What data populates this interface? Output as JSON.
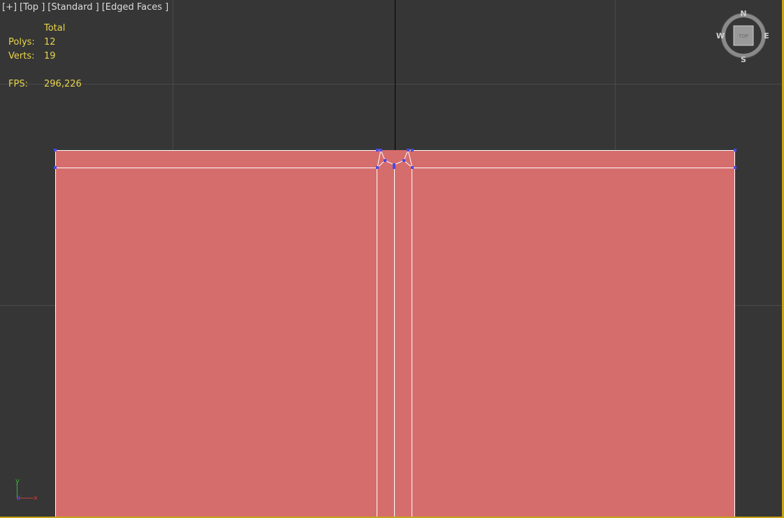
{
  "viewport_label": {
    "plus": "[+]",
    "view": "[Top ]",
    "shading": "[Standard ]",
    "edges": "[Edged Faces ]"
  },
  "stats": {
    "header": "Total",
    "polys_label": "Polys:",
    "polys_value": "12",
    "verts_label": "Verts:",
    "verts_value": "19",
    "fps_label": "FPS:",
    "fps_value": "296,226"
  },
  "viewcube": {
    "north": "N",
    "south": "S",
    "east": "E",
    "west": "W",
    "face": "TOP"
  },
  "axis_tripod": {
    "y": "y",
    "x": "x",
    "z": "z"
  },
  "colors": {
    "background": "#363636",
    "grid": "#4a4a4a",
    "mesh_fill": "#d66d6d",
    "mesh_edge": "#ffffff",
    "vertex": "#4a4ae6",
    "stats_text": "#e8d44a",
    "label_text": "#dcdcdc",
    "active_border": "#c8a418"
  }
}
